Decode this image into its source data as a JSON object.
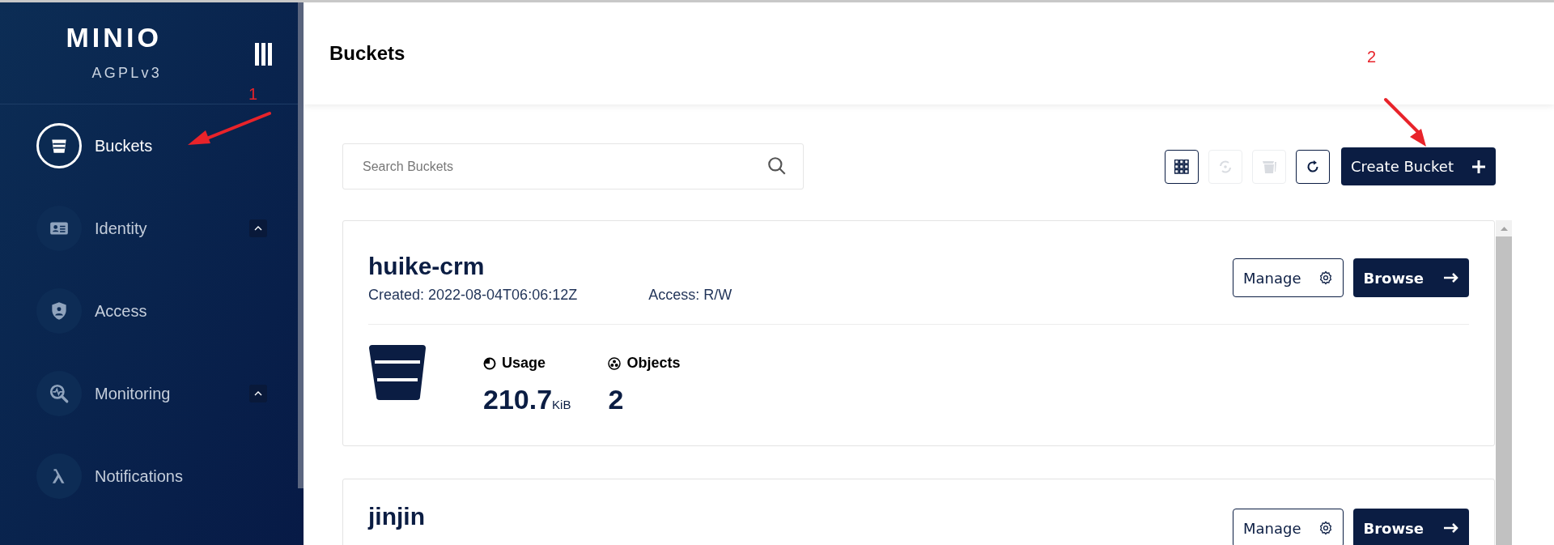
{
  "sidebar": {
    "logo": "MINIO",
    "license": "AGPLv3",
    "items": [
      {
        "label": "Buckets",
        "selected": true,
        "expandable": false
      },
      {
        "label": "Identity",
        "selected": false,
        "expandable": true
      },
      {
        "label": "Access",
        "selected": false,
        "expandable": false
      },
      {
        "label": "Monitoring",
        "selected": false,
        "expandable": true
      },
      {
        "label": "Notifications",
        "selected": false,
        "expandable": false
      }
    ]
  },
  "header": {
    "title": "Buckets"
  },
  "search": {
    "placeholder": "Search Buckets"
  },
  "toolbar": {
    "icon_buttons": [
      {
        "disabled": false
      },
      {
        "disabled": true
      },
      {
        "disabled": true
      },
      {
        "disabled": false
      }
    ],
    "create_button": "Create Bucket"
  },
  "buckets": [
    {
      "name": "huike-crm",
      "created": "Created: 2022-08-04T06:06:12Z",
      "access": "Access: R/W",
      "manage": "Manage",
      "browse": "Browse",
      "usage_label": "Usage",
      "usage_value": "210.7",
      "usage_unit": "KiB",
      "objects_label": "Objects",
      "objects_value": "2"
    },
    {
      "name": "jinjin",
      "manage": "Manage",
      "browse": "Browse"
    }
  ],
  "annotations": [
    {
      "label": "1"
    },
    {
      "label": "2"
    }
  ]
}
